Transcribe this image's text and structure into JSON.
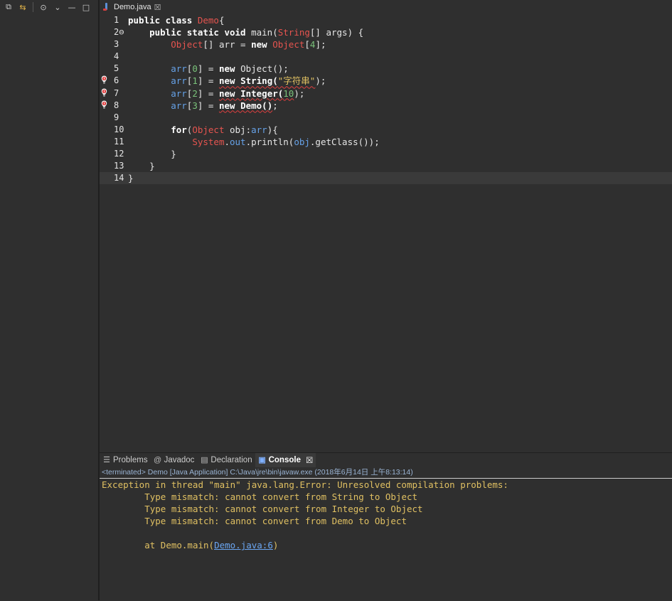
{
  "editor": {
    "tab_title": "Demo.java",
    "tab_close": "☒",
    "lines": [
      {
        "n": "1",
        "marker": false,
        "current": false,
        "tokens": [
          {
            "t": "public class ",
            "c": "kw"
          },
          {
            "t": "Demo",
            "c": "cls"
          },
          {
            "t": "{",
            "c": ""
          }
        ]
      },
      {
        "n": "2⊖",
        "marker": false,
        "current": false,
        "tokens": [
          {
            "t": "    public static void ",
            "c": "kw"
          },
          {
            "t": "main(",
            "c": ""
          },
          {
            "t": "String",
            "c": "cls"
          },
          {
            "t": "[] args) {",
            "c": ""
          }
        ]
      },
      {
        "n": "3",
        "marker": false,
        "current": false,
        "tokens": [
          {
            "t": "        ",
            "c": ""
          },
          {
            "t": "Object",
            "c": "cls"
          },
          {
            "t": "[] arr = ",
            "c": ""
          },
          {
            "t": "new ",
            "c": "kw"
          },
          {
            "t": "Object",
            "c": "cls"
          },
          {
            "t": "[",
            "c": ""
          },
          {
            "t": "4",
            "c": "num-lit"
          },
          {
            "t": "];",
            "c": ""
          }
        ]
      },
      {
        "n": "4",
        "marker": false,
        "current": false,
        "tokens": []
      },
      {
        "n": "5",
        "marker": false,
        "current": false,
        "tokens": [
          {
            "t": "        ",
            "c": ""
          },
          {
            "t": "arr",
            "c": "fld"
          },
          {
            "t": "[",
            "c": ""
          },
          {
            "t": "0",
            "c": "num-lit"
          },
          {
            "t": "] = ",
            "c": ""
          },
          {
            "t": "new ",
            "c": "kw"
          },
          {
            "t": "Object();",
            "c": ""
          }
        ]
      },
      {
        "n": "6",
        "marker": true,
        "current": false,
        "tokens": [
          {
            "t": "        ",
            "c": ""
          },
          {
            "t": "arr",
            "c": "fld"
          },
          {
            "t": "[",
            "c": ""
          },
          {
            "t": "1",
            "c": "num-lit"
          },
          {
            "t": "] = ",
            "c": ""
          },
          {
            "t": "new String(",
            "c": "kw squig"
          },
          {
            "t": "\"字符串\"",
            "c": "str squig"
          },
          {
            "t": ");",
            "c": ""
          }
        ]
      },
      {
        "n": "7",
        "marker": true,
        "current": false,
        "tokens": [
          {
            "t": "        ",
            "c": ""
          },
          {
            "t": "arr",
            "c": "fld"
          },
          {
            "t": "[",
            "c": ""
          },
          {
            "t": "2",
            "c": "num-lit"
          },
          {
            "t": "] = ",
            "c": ""
          },
          {
            "t": "new Integer(",
            "c": "kw squig"
          },
          {
            "t": "10",
            "c": "num-lit squig"
          },
          {
            "t": ");",
            "c": ""
          }
        ]
      },
      {
        "n": "8",
        "marker": true,
        "current": false,
        "tokens": [
          {
            "t": "        ",
            "c": ""
          },
          {
            "t": "arr",
            "c": "fld"
          },
          {
            "t": "[",
            "c": ""
          },
          {
            "t": "3",
            "c": "num-lit"
          },
          {
            "t": "] = ",
            "c": ""
          },
          {
            "t": "new Demo()",
            "c": "kw squig"
          },
          {
            "t": ";",
            "c": ""
          }
        ]
      },
      {
        "n": "9",
        "marker": false,
        "current": false,
        "tokens": []
      },
      {
        "n": "10",
        "marker": false,
        "current": false,
        "tokens": [
          {
            "t": "        ",
            "c": ""
          },
          {
            "t": "for",
            "c": "kw"
          },
          {
            "t": "(",
            "c": ""
          },
          {
            "t": "Object",
            "c": "cls"
          },
          {
            "t": " obj:",
            "c": ""
          },
          {
            "t": "arr",
            "c": "fld"
          },
          {
            "t": "){",
            "c": ""
          }
        ]
      },
      {
        "n": "11",
        "marker": false,
        "current": false,
        "tokens": [
          {
            "t": "            ",
            "c": ""
          },
          {
            "t": "System",
            "c": "cls"
          },
          {
            "t": ".",
            "c": ""
          },
          {
            "t": "out",
            "c": "fld"
          },
          {
            "t": ".println(",
            "c": ""
          },
          {
            "t": "obj",
            "c": "fld"
          },
          {
            "t": ".getClass());",
            "c": ""
          }
        ]
      },
      {
        "n": "12",
        "marker": false,
        "current": false,
        "tokens": [
          {
            "t": "        }",
            "c": ""
          }
        ]
      },
      {
        "n": "13",
        "marker": false,
        "current": false,
        "tokens": [
          {
            "t": "    }",
            "c": ""
          }
        ]
      },
      {
        "n": "14",
        "marker": false,
        "current": true,
        "tokens": [
          {
            "t": "}",
            "c": ""
          }
        ]
      }
    ]
  },
  "console": {
    "tabs": [
      {
        "label": "Problems",
        "icon": "problems-icon",
        "glyph": "☰",
        "active": false
      },
      {
        "label": "Javadoc",
        "icon": "javadoc-icon",
        "glyph": "@",
        "active": false
      },
      {
        "label": "Declaration",
        "icon": "declaration-icon",
        "glyph": "▤",
        "active": false
      },
      {
        "label": "Console",
        "icon": "console-icon",
        "glyph": "▣",
        "active": true
      }
    ],
    "close_glyph": "☒",
    "status": "<terminated> Demo [Java Application] C:\\Java\\jre\\bin\\javaw.exe (2018年6月14日 上午8:13:14)",
    "output": [
      "Exception in thread \"main\" java.lang.Error: Unresolved compilation problems: ",
      "\tType mismatch: cannot convert from String to Object",
      "\tType mismatch: cannot convert from Integer to Object",
      "\tType mismatch: cannot convert from Demo to Object",
      "",
      "\tat Demo.main("
    ],
    "link_text": "Demo.java:6",
    "link_suffix": ")"
  },
  "left_toolbar": {
    "glyphs": [
      "⧉",
      "⇆",
      "⊙",
      "⌄",
      "—",
      "□"
    ]
  }
}
